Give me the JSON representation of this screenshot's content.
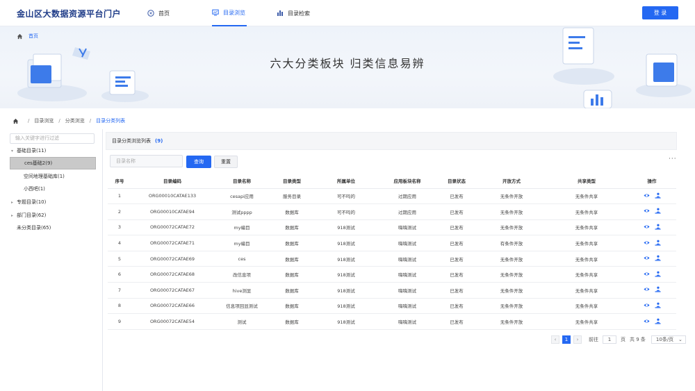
{
  "header": {
    "brand": "金山区大数据资源平台门户",
    "nav": [
      {
        "label": "首页",
        "icon": "home-circle-icon"
      },
      {
        "label": "目录浏览",
        "icon": "monitor-chart-icon",
        "active": true
      },
      {
        "label": "目录检索",
        "icon": "bar-chart-icon"
      }
    ],
    "login_label": "登 录"
  },
  "banner": {
    "crumb": "首页",
    "title": "六大分类板块      归类信息易辨"
  },
  "breadcrumb": [
    "目录浏览",
    "分类浏览",
    "目录分类列表"
  ],
  "sidebar": {
    "filter_placeholder": "输入关键字进行过滤",
    "items": [
      {
        "label": "基础目录(11)",
        "expanded": true
      },
      {
        "label": "ces基础2(9)",
        "selected": true
      },
      {
        "label": "空间地理基础库(1)"
      },
      {
        "label": "小西吧(1)"
      },
      {
        "label": "专题目录(10)"
      },
      {
        "label": "部门目录(62)"
      },
      {
        "label": "未分类目录(65)"
      }
    ]
  },
  "panel": {
    "title": "目录分类浏览列表",
    "count": "(9)",
    "search_placeholder": "目录名称",
    "query_label": "查询",
    "reset_label": "重置",
    "more": "···"
  },
  "table": {
    "headers": [
      "序号",
      "目录编码",
      "目录名称",
      "目录类型",
      "所属单位",
      "应用板块名称",
      "目录状态",
      "开放方式",
      "共享类型",
      "操作"
    ],
    "rows": [
      [
        "1",
        "ORG00010CATAE133",
        "cesapi应用",
        "服务目录",
        "可不吗的",
        "过期应用",
        "已发布",
        "无条件开放",
        "无条件共享"
      ],
      [
        "2",
        "ORG00010CATAE94",
        "测试pppp",
        "数据库",
        "可不吗的",
        "过期应用",
        "已发布",
        "无条件开放",
        "无条件共享"
      ],
      [
        "3",
        "ORG00072CATAE72",
        "my编目",
        "数据库",
        "918测试",
        "嗨嗨测试",
        "已发布",
        "无条件开放",
        "无条件共享"
      ],
      [
        "4",
        "ORG00072CATAE71",
        "my编目",
        "数据库",
        "918测试",
        "嗨嗨测试",
        "已发布",
        "有条件开放",
        "无条件共享"
      ],
      [
        "5",
        "ORG00072CATAE69",
        "ces",
        "数据库",
        "918测试",
        "嗨嗨测试",
        "已发布",
        "无条件开放",
        "无条件共享"
      ],
      [
        "6",
        "ORG00072CATAE68",
        "改信息项",
        "数据库",
        "918测试",
        "嗨嗨测试",
        "已发布",
        "无条件开放",
        "无条件共享"
      ],
      [
        "7",
        "ORG00072CATAE67",
        "hive测显",
        "数据库",
        "918测试",
        "嗨嗨测试",
        "已发布",
        "无条件开放",
        "无条件共享"
      ],
      [
        "8",
        "ORG00072CATAE66",
        "信息项回显测试",
        "数据库",
        "918测试",
        "嗨嗨测试",
        "已发布",
        "无条件开放",
        "无条件共享"
      ],
      [
        "9",
        "ORG00072CATAE54",
        "测试",
        "数据库",
        "918测试",
        "嗨嗨测试",
        "已发布",
        "无条件开放",
        "无条件共享"
      ]
    ]
  },
  "pager": {
    "prev": "‹",
    "current": "1",
    "next": "›",
    "goto_label": "前往",
    "goto_value": "1",
    "page_unit": "页",
    "total": "共 9 条",
    "page_size": "10条/页"
  },
  "colors": {
    "accent": "#2468f2",
    "brand": "#1f3c88"
  }
}
